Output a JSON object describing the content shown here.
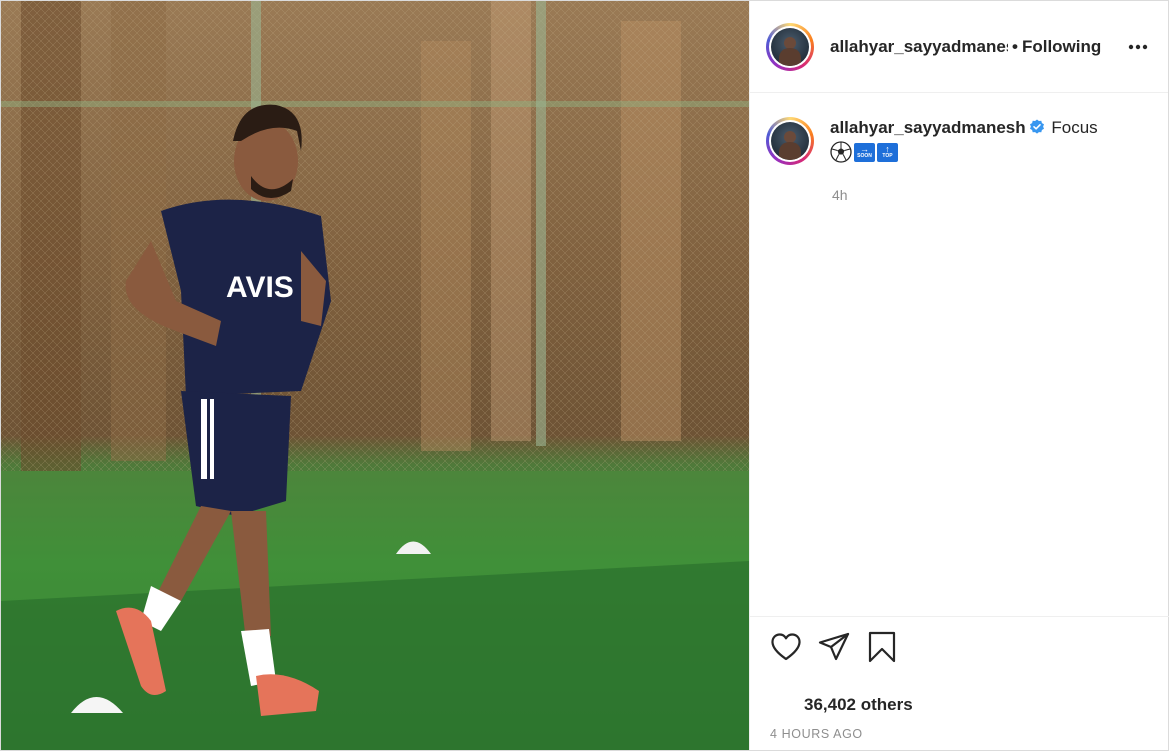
{
  "post": {
    "image": {
      "description_icon": "photo-icon"
    },
    "header": {
      "username": "allahyar_sayyadmanesh",
      "separator": "•",
      "follow_status": "Following",
      "more_icon": "more-horizontal-icon"
    },
    "caption": {
      "username": "allahyar_sayyadmanesh",
      "verified_icon": "verified-badge-icon",
      "text": "Focus",
      "emojis": [
        {
          "name": "soccer-ball-emoji-icon",
          "glyph": "⚽"
        },
        {
          "name": "soon-arrow-emoji-icon",
          "label": "SOON",
          "arrow": "→"
        },
        {
          "name": "top-arrow-emoji-icon",
          "label": "TOP",
          "arrow": "↑"
        }
      ],
      "time": "4h"
    },
    "actions": {
      "like_icon": "heart-icon",
      "share_icon": "paper-plane-icon",
      "save_icon": "bookmark-icon"
    },
    "likes_text": "36,402 others",
    "timestamp": "4 HOURS AGO",
    "colors": {
      "verified": "#3897f0",
      "muted_text": "#8e8e8e",
      "border": "#dbdbdb"
    }
  }
}
